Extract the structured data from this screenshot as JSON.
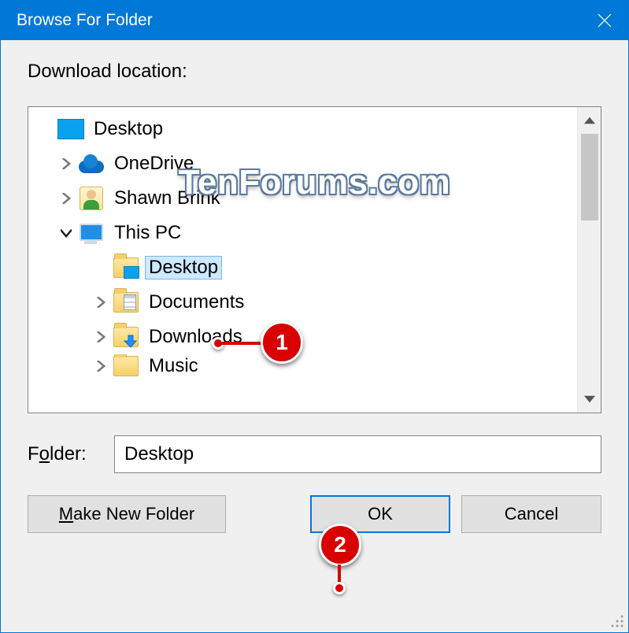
{
  "title": "Browse For Folder",
  "prompt": "Download location:",
  "watermark": "TenForums.com",
  "tree": {
    "root": "Desktop",
    "items": [
      {
        "label": "OneDrive",
        "icon": "onedrive",
        "expanded": false
      },
      {
        "label": "Shawn Brink",
        "icon": "user",
        "expanded": false
      },
      {
        "label": "This PC",
        "icon": "pc",
        "expanded": true,
        "children": [
          {
            "label": "Desktop",
            "icon": "folder-desktop",
            "selected": true
          },
          {
            "label": "Documents",
            "icon": "folder-documents"
          },
          {
            "label": "Downloads",
            "icon": "folder-downloads"
          },
          {
            "label": "Music",
            "icon": "folder-music",
            "cutoff": true
          }
        ]
      }
    ]
  },
  "folder_label_pre": "F",
  "folder_label_u": "o",
  "folder_label_post": "lder:",
  "folder_value": "Desktop",
  "buttons": {
    "make_u": "M",
    "make_rest": "ake New Folder",
    "ok": "OK",
    "cancel": "Cancel"
  },
  "annotations": [
    {
      "n": "1"
    },
    {
      "n": "2"
    }
  ]
}
